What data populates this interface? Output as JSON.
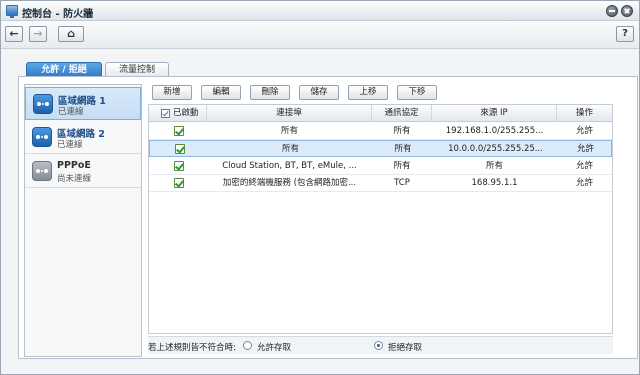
{
  "window": {
    "title": "控制台 - 防火牆"
  },
  "toolbar": {
    "back": "←",
    "forward": "→",
    "home": "⌂",
    "help": "?"
  },
  "tabs": [
    {
      "label": "允許 / 拒絕"
    },
    {
      "label": "流量控制"
    }
  ],
  "sidebar": {
    "items": [
      {
        "name": "區域網路 1",
        "status": "已連線"
      },
      {
        "name": "區域網路 2",
        "status": "已連線"
      },
      {
        "name": "PPPoE",
        "status": "尚未連線"
      }
    ]
  },
  "actions": {
    "add": "新增",
    "edit": "編輯",
    "delete": "刪除",
    "save": "儲存",
    "up": "上移",
    "down": "下移"
  },
  "table": {
    "headers": {
      "enabled": "已啟動",
      "ports": "連接埠",
      "protocol": "通訊協定",
      "source_ip": "來源 IP",
      "action": "操作"
    },
    "rows": [
      {
        "ports": "所有",
        "protocol": "所有",
        "source_ip": "192.168.1.0/255.255...",
        "action": "允許"
      },
      {
        "ports": "所有",
        "protocol": "所有",
        "source_ip": "10.0.0.0/255.255.25...",
        "action": "允許"
      },
      {
        "ports": "Cloud Station, BT, BT, eMule, ...",
        "protocol": "所有",
        "source_ip": "所有",
        "action": "允許"
      },
      {
        "ports": "加密的終端機服務 (包含網路加密...",
        "protocol": "TCP",
        "source_ip": "168.95.1.1",
        "action": "允許"
      }
    ]
  },
  "footer": {
    "label": "若上述規則皆不符合時:",
    "allow": "允許存取",
    "deny": "拒絕存取",
    "selected": "deny"
  }
}
